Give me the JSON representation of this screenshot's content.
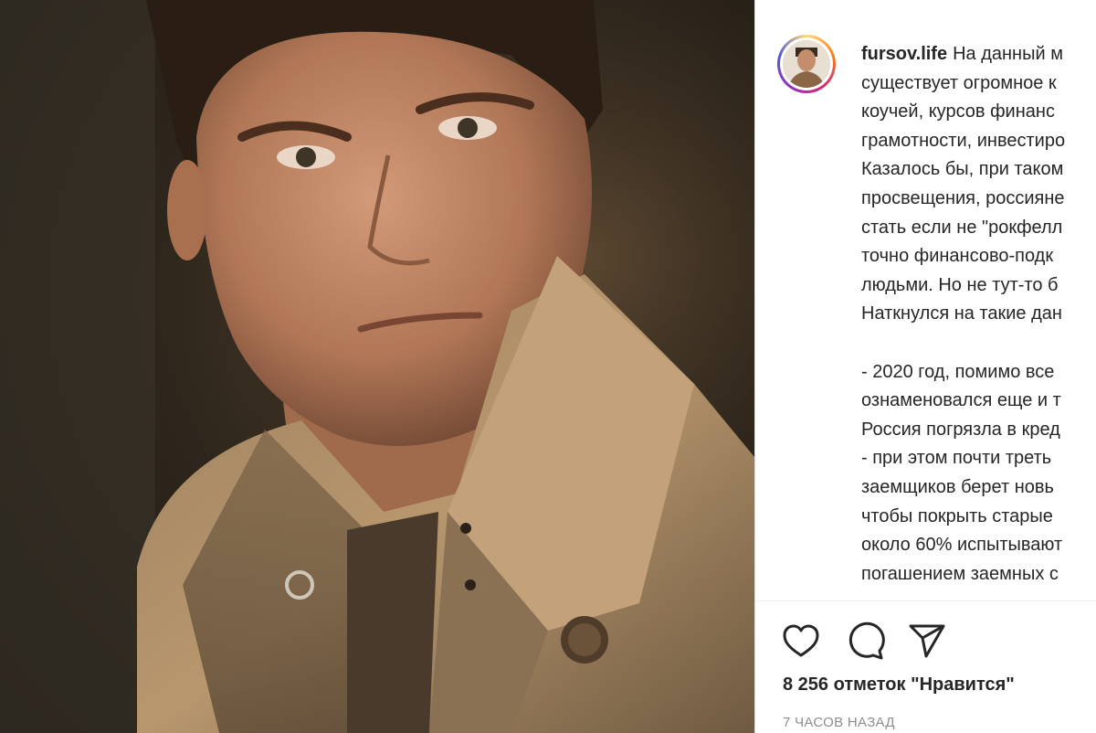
{
  "post": {
    "image_alt": "portrait",
    "username": "fursov.life",
    "caption_lines": [
      "На данный м",
      "существует огромное к",
      "коучей, курсов финанс",
      "грамотности, инвестиро",
      "Казалось бы, при таком",
      "просвещения, россияне",
      "стать если не \"рокфелл",
      "точно финансово-подк",
      "людьми. Но не тут-то б",
      "Наткнулся на такие дан",
      "",
      "- 2020 год, помимо все",
      "ознаменовался еще и т",
      "Россия погрязла в кред",
      "- при этом почти треть",
      "заемщиков берет новь",
      "чтобы покрыть старые",
      "около 60% испытывают",
      "погашением заемных с"
    ],
    "likes_text": "8 256 отметок \"Нравится\"",
    "time_text": "7 ЧАСОВ НАЗАД"
  },
  "actions": {
    "like_icon": "heart-icon",
    "comment_icon": "comment-icon",
    "share_icon": "share-icon"
  },
  "colors": {
    "text": "#262626",
    "muted": "#8e8e8e",
    "border": "#dbdbdb"
  }
}
